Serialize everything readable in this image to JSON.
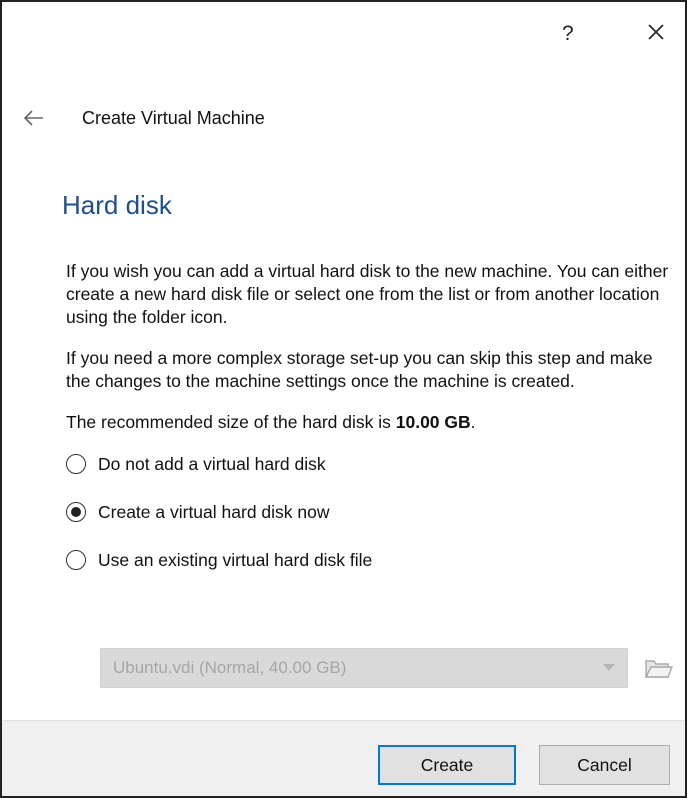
{
  "titlebar": {
    "help_label": "?",
    "close_icon": "close-icon"
  },
  "nav": {
    "back_icon": "back-arrow-icon",
    "title": "Create Virtual Machine"
  },
  "page": {
    "heading": "Hard disk",
    "paragraph1": "If you wish you can add a virtual hard disk to the new machine. You can either create a new hard disk file or select one from the list or from another location using the folder icon.",
    "paragraph2": "If you need a more complex storage set-up you can skip this step and make the changes to the machine settings once the machine is created.",
    "recommended_prefix": "The recommended size of the hard disk is ",
    "recommended_size": "10.00 GB",
    "recommended_suffix": "."
  },
  "options": [
    {
      "label": "Do not add a virtual hard disk",
      "checked": false
    },
    {
      "label": "Create a virtual hard disk now",
      "checked": true
    },
    {
      "label": "Use an existing virtual hard disk file",
      "checked": false
    }
  ],
  "existing_disk": {
    "selected_value": "Ubuntu.vdi (Normal, 40.00 GB)",
    "disabled": true,
    "folder_icon": "folder-icon"
  },
  "footer": {
    "create_label": "Create",
    "cancel_label": "Cancel"
  },
  "colors": {
    "heading": "#1f4e8c",
    "focus_border": "#0078d7",
    "disabled_field": "#d9d9d9",
    "footer_bg": "#f0f0f0"
  }
}
